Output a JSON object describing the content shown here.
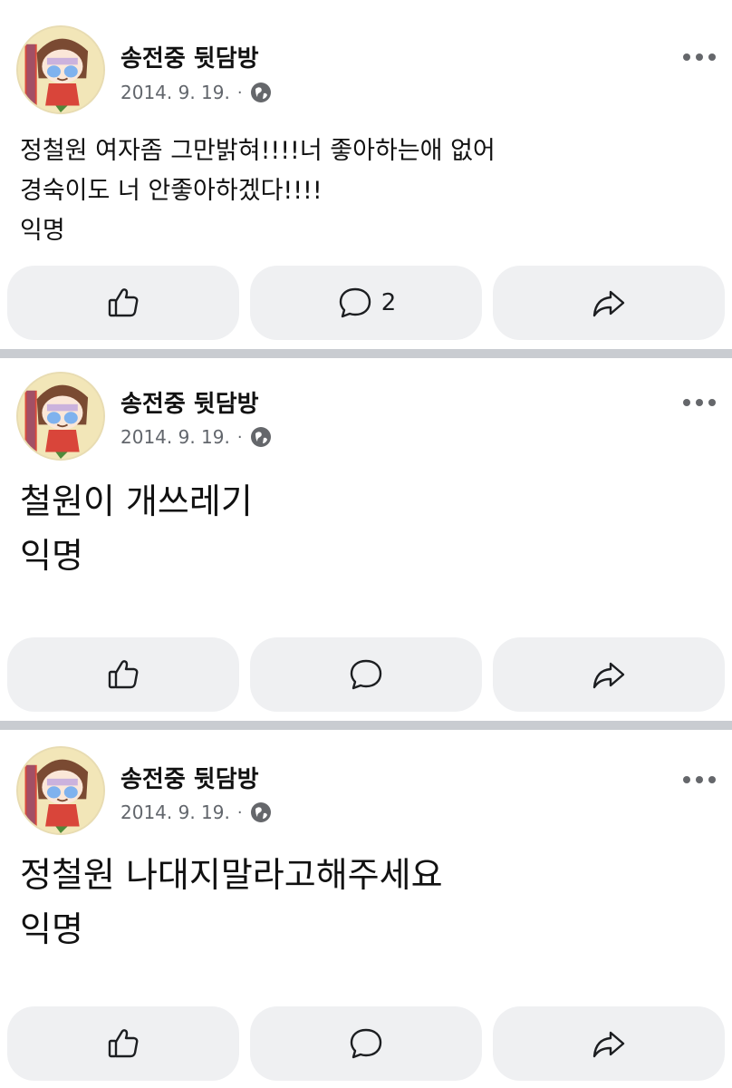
{
  "posts": [
    {
      "author": "송전중 뒷담방",
      "date": "2014. 9. 19.",
      "separator": "·",
      "text": "정철원 여자좀 그만밝혀!!!!너 좋아하는애 없어\n경숙이도 너 안좋아하겠다!!!!\n익명",
      "comment_count": "2",
      "icons": {
        "like": "thumbs-up-icon",
        "comment": "comment-bubble-icon",
        "share": "share-arrow-icon",
        "privacy": "globe-icon",
        "more": "more-dots-icon"
      }
    },
    {
      "author": "송전중 뒷담방",
      "date": "2014. 9. 19.",
      "separator": "·",
      "text": "철원이 개쓰레기\n익명",
      "comment_count": "",
      "icons": {
        "like": "thumbs-up-icon",
        "comment": "comment-bubble-icon",
        "share": "share-arrow-icon",
        "privacy": "globe-icon",
        "more": "more-dots-icon"
      }
    },
    {
      "author": "송전중 뒷담방",
      "date": "2014. 9. 19.",
      "separator": "·",
      "text": "정철원 나대지말라고해주세요\n익명",
      "comment_count": "",
      "icons": {
        "like": "thumbs-up-icon",
        "comment": "comment-bubble-icon",
        "share": "share-arrow-icon",
        "privacy": "globe-icon",
        "more": "more-dots-icon"
      }
    }
  ],
  "colors": {
    "background": "#ffffff",
    "separator": "#c9ccd1",
    "button_bg": "#eff0f2",
    "meta_text": "#62666c",
    "icon": "#1c1e21"
  }
}
